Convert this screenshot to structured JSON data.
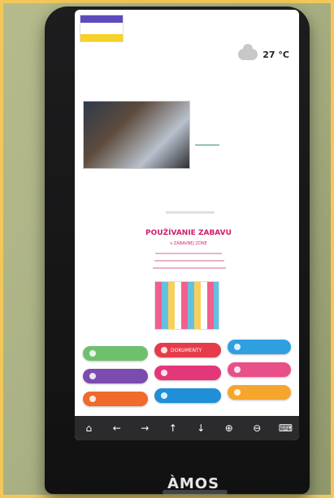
{
  "header": {
    "temperature": "27 °C",
    "icons": {
      "logo": "logo-icon",
      "weather": "cloud-icon"
    }
  },
  "news": {
    "title": "",
    "text": ""
  },
  "promo": {
    "title": "POUŽÍVANIE ZABAVU",
    "subtitle": "v ZÁBAVNEJ ZÓNE"
  },
  "buttons": [
    {
      "label": "",
      "color": "#6fc06c",
      "icon": "compass-icon"
    },
    {
      "label": "DOKUMENTY",
      "color": "#e63c4a",
      "icon": "document-icon"
    },
    {
      "label": "",
      "color": "#2f9fe0",
      "icon": "gear-icon"
    },
    {
      "label": "",
      "color": "#7b4bb0",
      "icon": "info-icon"
    },
    {
      "label": "",
      "color": "#e3377a",
      "icon": "image-icon"
    },
    {
      "label": "",
      "color": "#e8508a",
      "icon": "heart-icon"
    },
    {
      "label": "",
      "color": "#ef6a2b",
      "icon": "tools-icon"
    },
    {
      "label": "",
      "color": "#1f8fd7",
      "icon": "clock-icon"
    },
    {
      "label": "",
      "color": "#f6a62d",
      "icon": "star-icon"
    }
  ],
  "navbar": {
    "items": [
      "home-icon",
      "arrow-left-icon",
      "arrow-right-icon",
      "arrow-up-icon",
      "arrow-down-icon",
      "zoom-in-icon",
      "zoom-out-icon",
      "keyboard-icon"
    ]
  },
  "brand": {
    "name": "ÀMOS"
  }
}
